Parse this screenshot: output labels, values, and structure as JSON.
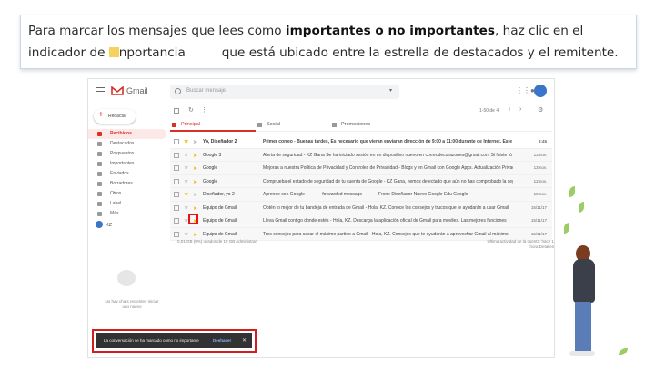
{
  "caption": {
    "line1_a": "Para marcar los mensajes que lees como ",
    "line1_bold": "importantes o no importantes",
    "line1_b": ", haz clic en el",
    "line2_a": "indicador de ",
    "line2_b": "nportancia",
    "line2_c": "que está ubicado entre la estrella de destacados y el remitente."
  },
  "gmail": {
    "logo_text": "Gmail",
    "search_placeholder": "Buscar mensaje",
    "compose_label": "Redactar",
    "nav": [
      {
        "label": "Recibidos",
        "active": true
      },
      {
        "label": "Destacados"
      },
      {
        "label": "Pospuestos"
      },
      {
        "label": "Importantes"
      },
      {
        "label": "Enviados"
      },
      {
        "label": "Borradores"
      },
      {
        "label": "Otros"
      },
      {
        "label": "Label"
      },
      {
        "label": "Más"
      }
    ],
    "chat_user": "KZ",
    "no_chats": "No hay chats recientes Iniciar uno nuevo",
    "pagination": "1-50 de 4",
    "tabs": [
      {
        "label": "Principal",
        "active": true
      },
      {
        "label": "Social"
      },
      {
        "label": "Promociones"
      }
    ],
    "rows": [
      {
        "sender": "Yo, Diseñador 2",
        "subject": "Primer correo - Buenas tardes, Es necesario que vieran enviaran dirección de 9:00 a 11:00 durante de Internet. Este es un",
        "date": "8:45",
        "unread": true,
        "starred": true,
        "important": false
      },
      {
        "sender": "Google 3",
        "subject": "Alerta de seguridad - KZ Gana Se ha iniciado sesión en un dispositivo nuevo en correodecorazones@gmail.com Si fuiste tú",
        "date": "13 nov.",
        "unread": false,
        "starred": false,
        "important": true
      },
      {
        "sender": "Google",
        "subject": "Mejoras a nuestra Política de Privacidad y Controles de Privacidad - Blogs y en Gmail con Google Apps. Actualización Privacidad",
        "date": "13 nov.",
        "unread": false,
        "starred": false,
        "important": true
      },
      {
        "sender": "Google",
        "subject": "Comprueba el estado de seguridad de tu cuenta de Google - KZ Gana, hemos detectado que aún no has comprobado la seguridad",
        "date": "12 nov.",
        "unread": false,
        "starred": false,
        "important": true
      },
      {
        "sender": "Diseñador, yo 2",
        "subject": "Aprende con Google ---------- forwarded message --------- From: Diseñador Nuevo Google Edu Google",
        "date": "15 nov.",
        "unread": false,
        "starred": true,
        "important": false
      },
      {
        "sender": "Equipo de Gmail",
        "subject": "Obtén lo mejor de tu bandeja de entrada de Gmail - Hola, KZ. Conoce los consejos y trucos que te ayudarán a usar Gmail",
        "date": "15/11/17",
        "unread": false,
        "starred": false,
        "important": true
      },
      {
        "sender": "Equipo de Gmail",
        "subject": "Lleva Gmail contigo donde estés - Hola, KZ. Descarga la aplicación oficial de Gmail para móviles. Las mejores funciones",
        "date": "15/11/17",
        "unread": false,
        "starred": false,
        "important": true
      },
      {
        "sender": "Equipo de Gmail",
        "subject": "Tres consejos para sacar el máximo partido a Gmail - Hola, KZ. Consejos que te ayudarán a aprovechar Gmail al máximo",
        "date": "15/11/17",
        "unread": false,
        "starred": false,
        "important": true
      }
    ],
    "footer_left": "0,01 GB (0%) usados de 15 GB Administrar",
    "footer_right": "Última actividad de la cuenta: hace 1 hora Detalles",
    "snackbar_text": "La conversación se ha marcado como no importante",
    "snackbar_action": "Deshacer",
    "snackbar_close": "✕"
  }
}
